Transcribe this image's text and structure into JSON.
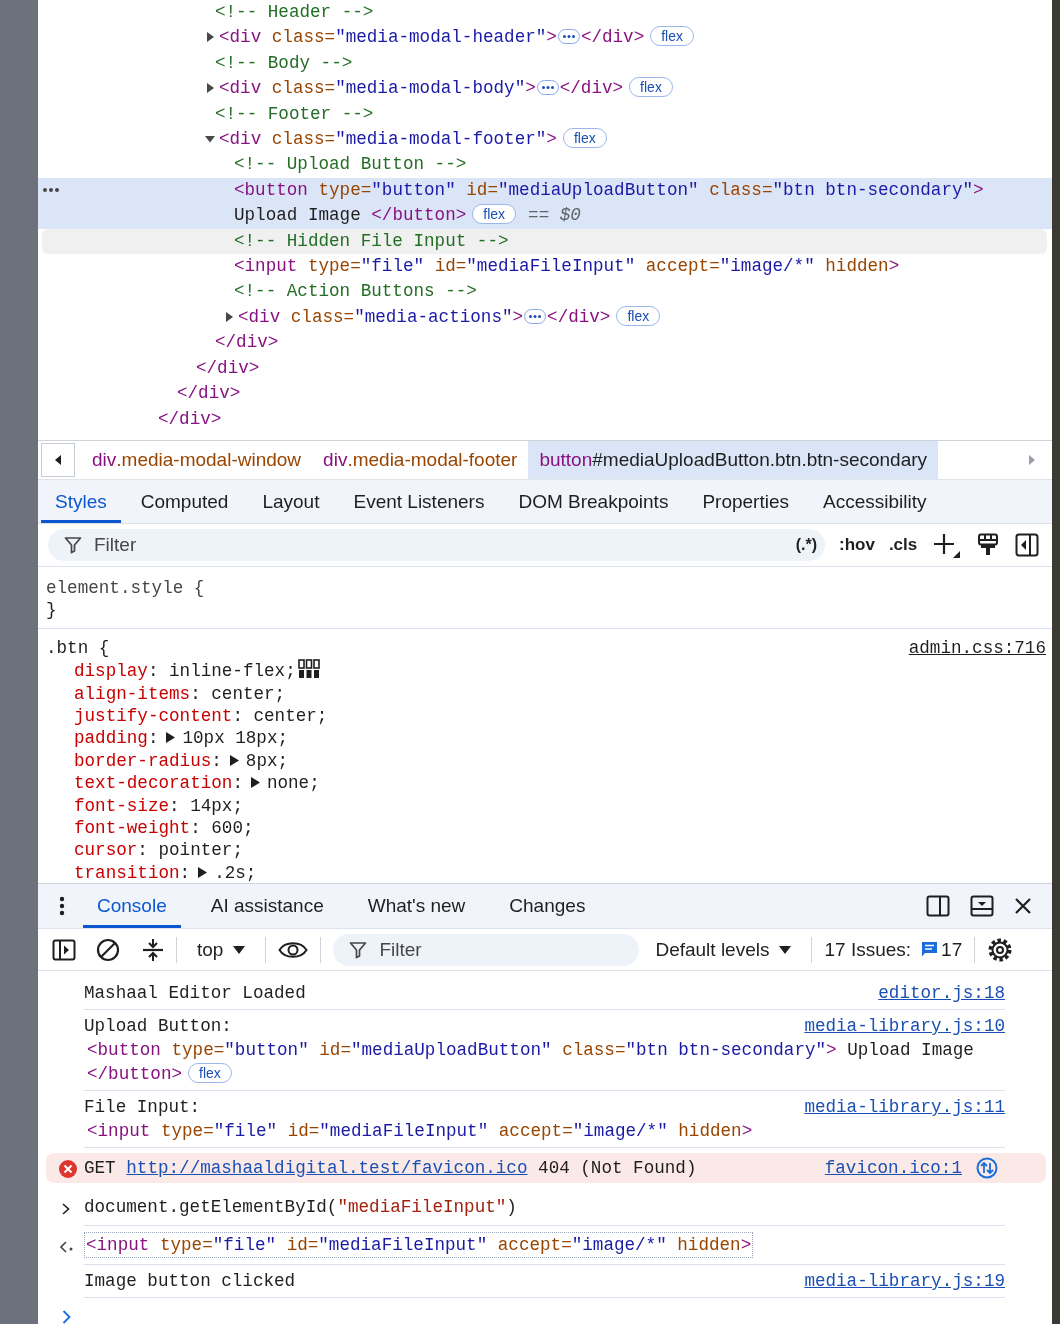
{
  "elements_tree": {
    "nodes": [
      {
        "children": [
          {
            "children": [
              {
                "children": [
                  {
                    "open": [
                      {
                        "kind": "comment",
                        "text": "<!-- Header -->"
                      }
                    ],
                    "selected": false,
                    "hovered": false
                  },
                  {
                    "open": [
                      {
                        "kind": "tag",
                        "text": "<div"
                      },
                      {
                        "kind": "attr",
                        "text": " class="
                      },
                      {
                        "kind": "value",
                        "text": "\"media-modal-header\""
                      },
                      {
                        "kind": "tag",
                        "text": ">"
                      },
                      {
                        "kind": "ellipsis"
                      },
                      {
                        "kind": "tag",
                        "text": "</div>"
                      },
                      {
                        "kind": "badge",
                        "text": "flex"
                      }
                    ],
                    "expanded": false,
                    "selected": false,
                    "hovered": false
                  },
                  {
                    "open": [
                      {
                        "kind": "comment",
                        "text": "<!-- Body -->"
                      }
                    ],
                    "selected": false,
                    "hovered": false
                  },
                  {
                    "open": [
                      {
                        "kind": "tag",
                        "text": "<div"
                      },
                      {
                        "kind": "attr",
                        "text": " class="
                      },
                      {
                        "kind": "value",
                        "text": "\"media-modal-body\""
                      },
                      {
                        "kind": "tag",
                        "text": ">"
                      },
                      {
                        "kind": "ellipsis"
                      },
                      {
                        "kind": "tag",
                        "text": "</div>"
                      },
                      {
                        "kind": "badge",
                        "text": "flex"
                      }
                    ],
                    "expanded": false,
                    "selected": false,
                    "hovered": false
                  },
                  {
                    "open": [
                      {
                        "kind": "comment",
                        "text": "<!-- Footer -->"
                      }
                    ],
                    "selected": false,
                    "hovered": false
                  },
                  {
                    "open": [
                      {
                        "kind": "tag",
                        "text": "<div"
                      },
                      {
                        "kind": "attr",
                        "text": " class="
                      },
                      {
                        "kind": "value",
                        "text": "\"media-modal-footer\""
                      },
                      {
                        "kind": "tag",
                        "text": ">"
                      },
                      {
                        "kind": "badge",
                        "text": "flex"
                      }
                    ],
                    "expanded": true,
                    "selected": false,
                    "hovered": false,
                    "children": [
                      {
                        "open": [
                          {
                            "kind": "comment",
                            "text": "<!-- Upload Button -->"
                          }
                        ],
                        "selected": false,
                        "hovered": false
                      },
                      {
                        "open": [
                          {
                            "kind": "tag",
                            "text": "<button"
                          },
                          {
                            "kind": "attr",
                            "text": " type="
                          },
                          {
                            "kind": "value",
                            "text": "\"button\""
                          },
                          {
                            "kind": "attr",
                            "text": " id="
                          },
                          {
                            "kind": "value",
                            "text": "\"mediaUploadButton\""
                          },
                          {
                            "kind": "attr",
                            "text": " class="
                          },
                          {
                            "kind": "value",
                            "text": "\"btn btn-secondary\""
                          },
                          {
                            "kind": "tag",
                            "text": ">"
                          },
                          {
                            "kind": "text",
                            "text": " Upload Image "
                          },
                          {
                            "kind": "tag",
                            "text": "</button>"
                          },
                          {
                            "kind": "badge",
                            "text": "flex"
                          },
                          {
                            "kind": "ref",
                            "text": "== *$0*"
                          }
                        ],
                        "selected": true,
                        "hovered": false
                      },
                      {
                        "open": [
                          {
                            "kind": "comment",
                            "text": "<!-- Hidden File Input -->"
                          }
                        ],
                        "selected": false,
                        "hovered": true
                      },
                      {
                        "open": [
                          {
                            "kind": "tag",
                            "text": "<input"
                          },
                          {
                            "kind": "attr",
                            "text": " type="
                          },
                          {
                            "kind": "value",
                            "text": "\"file\""
                          },
                          {
                            "kind": "attr",
                            "text": " id="
                          },
                          {
                            "kind": "value",
                            "text": "\"mediaFileInput\""
                          },
                          {
                            "kind": "attr",
                            "text": " accept="
                          },
                          {
                            "kind": "value",
                            "text": "\"image/*\""
                          },
                          {
                            "kind": "attr",
                            "text": " hidden"
                          },
                          {
                            "kind": "tag",
                            "text": ">"
                          }
                        ],
                        "selected": false,
                        "hovered": false
                      },
                      {
                        "open": [
                          {
                            "kind": "comment",
                            "text": "<!-- Action Buttons -->"
                          }
                        ],
                        "selected": false,
                        "hovered": false
                      },
                      {
                        "open": [
                          {
                            "kind": "tag",
                            "text": "<div"
                          },
                          {
                            "kind": "attr",
                            "text": " class="
                          },
                          {
                            "kind": "value",
                            "text": "\"media-actions\""
                          },
                          {
                            "kind": "tag",
                            "text": ">"
                          },
                          {
                            "kind": "ellipsis"
                          },
                          {
                            "kind": "tag",
                            "text": "</div>"
                          },
                          {
                            "kind": "badge",
                            "text": "flex"
                          }
                        ],
                        "expanded": false,
                        "selected": false,
                        "hovered": false
                      }
                    ],
                    "close": [
                      {
                        "kind": "tag",
                        "text": "</div>"
                      }
                    ]
                  }
                ],
                "close": [
                  {
                    "kind": "tag",
                    "text": "</div>"
                  }
                ]
              }
            ],
            "close": [
              {
                "kind": "tag",
                "text": "</div>"
              }
            ]
          }
        ],
        "close": [
          {
            "kind": "tag",
            "text": "</div>"
          }
        ]
      }
    ]
  },
  "breadcrumbs": [
    {
      "tag": "div",
      "rest": ".media-modal-window",
      "selected": false
    },
    {
      "tag": "div",
      "rest": ".media-modal-footer",
      "selected": false
    },
    {
      "tag": "button",
      "rest": "#mediaUploadButton.btn.btn-secondary",
      "selected": true
    }
  ],
  "styles_tabs": [
    {
      "label": "Styles",
      "selected": true
    },
    {
      "label": "Computed",
      "selected": false
    },
    {
      "label": "Layout",
      "selected": false
    },
    {
      "label": "Event Listeners",
      "selected": false
    },
    {
      "label": "DOM Breakpoints",
      "selected": false
    },
    {
      "label": "Properties",
      "selected": false
    },
    {
      "label": "Accessibility",
      "selected": false
    }
  ],
  "styles_toolbar": {
    "filter": {
      "placeholder": "Filter"
    },
    "regex": "(.*)",
    "hov": ":hov",
    "cls": ".cls"
  },
  "rules": [
    {
      "selector": "element.style {",
      "kind": "inline",
      "close": "}"
    },
    {
      "selector": ".btn {",
      "kind": "sheet",
      "source": "admin.css:716",
      "properties": [
        {
          "name": "display",
          "punct": ":",
          "value": "inline-flex;",
          "kind": "flex"
        },
        {
          "name": "align-items",
          "punct": ":",
          "value": "center;",
          "kind": "plain"
        },
        {
          "name": "justify-content",
          "punct": ":",
          "value": "center;",
          "kind": "plain"
        },
        {
          "name": "padding",
          "punct": ":",
          "value": "10px 18px;",
          "kind": "expandable"
        },
        {
          "name": "border-radius",
          "punct": ":",
          "value": "8px;",
          "kind": "expandable"
        },
        {
          "name": "text-decoration",
          "punct": ":",
          "value": "none;",
          "kind": "expandable"
        },
        {
          "name": "font-size",
          "punct": ":",
          "value": "14px;",
          "kind": "plain"
        },
        {
          "name": "font-weight",
          "punct": ":",
          "value": "600;",
          "kind": "plain"
        },
        {
          "name": "cursor",
          "punct": ":",
          "value": "pointer;",
          "kind": "plain"
        },
        {
          "name": "transition",
          "punct": ":",
          "value": ".2s;",
          "kind": "expandable"
        }
      ]
    }
  ],
  "drawer_tabs": [
    {
      "label": "Console",
      "selected": true
    },
    {
      "label": "AI assistance",
      "selected": false
    },
    {
      "label": "What's new",
      "selected": false
    },
    {
      "label": "Changes",
      "selected": false
    }
  ],
  "console_toolbar": {
    "context": "top",
    "filter": {
      "placeholder": "Filter"
    },
    "levels": "Default levels",
    "issues_label": "17 Issues:",
    "issues_count": "17"
  },
  "messages": [
    {
      "kind": "log",
      "text": "Mashaal Editor Loaded",
      "source": "editor.js:18"
    },
    {
      "kind": "log",
      "text": "Upload Button:",
      "source": "media-library.js:10",
      "node": [
        {
          "kind": "tag",
          "text": "<button"
        },
        {
          "kind": "attr",
          "text": " type="
        },
        {
          "kind": "value",
          "text": "\"button\""
        },
        {
          "kind": "attr",
          "text": " id="
        },
        {
          "kind": "value",
          "text": "\"mediaUploadButton\""
        },
        {
          "kind": "attr",
          "text": " class="
        },
        {
          "kind": "value",
          "text": "\"btn btn-secondary\""
        },
        {
          "kind": "tag",
          "text": ">"
        },
        {
          "kind": "text",
          "text": " Upload Image "
        },
        {
          "kind": "tag",
          "text": "</button>"
        },
        {
          "kind": "badge",
          "text": "flex"
        }
      ]
    },
    {
      "kind": "log",
      "text": "File Input:",
      "source": "media-library.js:11",
      "node": [
        {
          "kind": "tag",
          "text": "<input"
        },
        {
          "kind": "attr",
          "text": " type="
        },
        {
          "kind": "value",
          "text": "\"file\""
        },
        {
          "kind": "attr",
          "text": " id="
        },
        {
          "kind": "value",
          "text": "\"mediaFileInput\""
        },
        {
          "kind": "attr",
          "text": " accept="
        },
        {
          "kind": "value",
          "text": "\"image/*\""
        },
        {
          "kind": "attr",
          "text": " hidden"
        },
        {
          "kind": "tag",
          "text": ">"
        }
      ]
    },
    {
      "kind": "error",
      "method": "GET",
      "url": "http://mashaaldigital.test/favicon.ico",
      "status": "404 (Not Found)",
      "source": "favicon.ico:1"
    },
    {
      "kind": "command",
      "code": [
        {
          "kind": "code",
          "text": "document.getElementById("
        },
        {
          "kind": "string",
          "text": "\"mediaFileInput\""
        },
        {
          "kind": "code",
          "text": ")"
        }
      ]
    },
    {
      "kind": "result",
      "node": [
        {
          "kind": "tag",
          "text": "<input"
        },
        {
          "kind": "attr",
          "text": " type="
        },
        {
          "kind": "value",
          "text": "\"file\""
        },
        {
          "kind": "attr",
          "text": " id="
        },
        {
          "kind": "value",
          "text": "\"mediaFileInput\""
        },
        {
          "kind": "attr",
          "text": " accept="
        },
        {
          "kind": "value",
          "text": "\"image/*\""
        },
        {
          "kind": "attr",
          "text": " hidden"
        },
        {
          "kind": "tag",
          "text": ">"
        }
      ]
    },
    {
      "kind": "log",
      "text": "Image button clicked",
      "source": "media-library.js:19"
    },
    {
      "kind": "prompt"
    }
  ]
}
